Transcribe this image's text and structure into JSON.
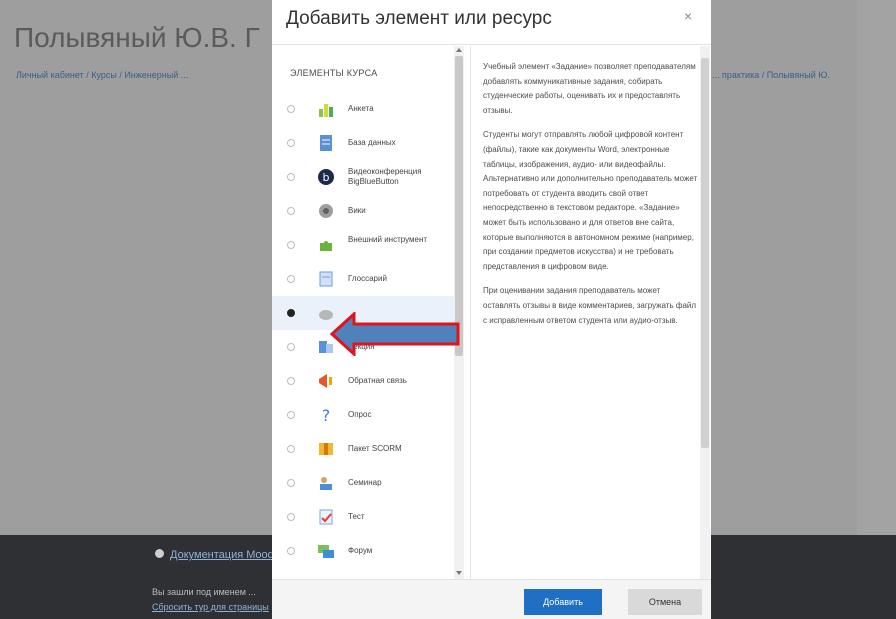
{
  "background": {
    "title": "Полывяный Ю.В. Г",
    "breadcrumb_left": "Личный кабинет / Курсы / Инженерный ...",
    "breadcrumb_right": "... практика / Полывяный Ю.",
    "footer_help": "Документация Moodle",
    "footer_login": "Вы зашли под именем ...",
    "footer_link": "Сбросить тур для страницы"
  },
  "modal": {
    "title": "Добавить элемент или ресурс",
    "close_label": "×",
    "section_header": "ЭЛЕМЕНТЫ КУРСА",
    "items": [
      {
        "label": "Анкета",
        "icon": "survey-chart-icon",
        "selected": false
      },
      {
        "label": "База данных",
        "icon": "database-icon",
        "selected": false
      },
      {
        "label": "Видеоконференция BigBlueButton",
        "icon": "bigbluebutton-icon",
        "selected": false
      },
      {
        "label": "Вики",
        "icon": "wiki-icon",
        "selected": false
      },
      {
        "label": "Внешний инструмент",
        "icon": "puzzle-icon",
        "selected": false
      },
      {
        "label": "Глоссарий",
        "icon": "glossary-icon",
        "selected": false
      },
      {
        "label": "Задание",
        "icon": "assignment-icon",
        "selected": true
      },
      {
        "label": "Лекция",
        "icon": "lesson-icon",
        "selected": false
      },
      {
        "label": "Обратная связь",
        "icon": "feedback-icon",
        "selected": false
      },
      {
        "label": "Опрос",
        "icon": "choice-question-icon",
        "selected": false
      },
      {
        "label": "Пакет SCORM",
        "icon": "scorm-package-icon",
        "selected": false
      },
      {
        "label": "Семинар",
        "icon": "workshop-icon",
        "selected": false
      },
      {
        "label": "Тест",
        "icon": "quiz-icon",
        "selected": false
      },
      {
        "label": "Форум",
        "icon": "forum-icon",
        "selected": false
      }
    ],
    "description": [
      "Учебный элемент «Задание» позволяет преподавателям добавлять коммуникативные задания, собирать студенческие работы, оценивать их и предоставлять отзывы.",
      "Студенты могут отправлять любой цифровой контент (файлы), такие как документы Word, электронные таблицы, изображения, аудио- или видеофайлы. Альтернативно или дополнительно преподаватель может потребовать от студента вводить свой ответ непосредственно в текстовом редакторе. «Задание» может быть использовано и для ответов вне сайта, которые выполняются в автономном режиме (например, при создании предметов искусства) и не требовать представления в цифровом виде.",
      "При оценивании задания преподаватель может оставлять отзывы в виде комментариев, загружать файл с исправленным ответом студента или аудио-отзыв."
    ],
    "add_button": "Добавить",
    "cancel_button": "Отмена"
  },
  "colors": {
    "primary_button": "#1f6fc4",
    "annotation_arrow_fill": "#4f81bd",
    "annotation_arrow_border": "#e0141b",
    "footer_bg": "#2f3033"
  }
}
